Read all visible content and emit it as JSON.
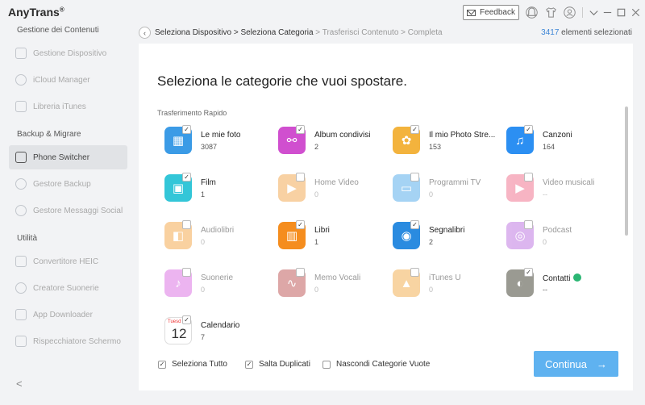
{
  "app": {
    "name": "AnyTrans",
    "reg": "®"
  },
  "titlebar": {
    "feedback_label": "Feedback",
    "icons": [
      "bell-icon",
      "tshirt-icon",
      "user-icon",
      "chevron-down-icon",
      "minimize-icon",
      "maximize-icon",
      "close-icon"
    ]
  },
  "sidebar": {
    "sections": [
      {
        "title": "Gestione dei Contenuti",
        "items": [
          {
            "label": "Gestione Dispositivo",
            "icon": "device-icon"
          },
          {
            "label": "iCloud Manager",
            "icon": "cloud-icon"
          },
          {
            "label": "Libreria iTunes",
            "icon": "music-library-icon"
          }
        ]
      },
      {
        "title": "Backup & Migrare",
        "items": [
          {
            "label": "Phone Switcher",
            "icon": "phone-switch-icon",
            "active": true
          },
          {
            "label": "Gestore Backup",
            "icon": "backup-icon"
          },
          {
            "label": "Gestore Messaggi Social",
            "icon": "chat-icon"
          }
        ]
      },
      {
        "title": "Utilità",
        "items": [
          {
            "label": "Convertitore HEIC",
            "icon": "heic-icon"
          },
          {
            "label": "Creatore Suonerie",
            "icon": "bell-icon"
          },
          {
            "label": "App Downloader",
            "icon": "download-icon"
          },
          {
            "label": "Rispecchiatore Schermo",
            "icon": "screen-mirror-icon"
          }
        ]
      }
    ],
    "collapse_glyph": "<"
  },
  "breadcrumb": {
    "back_glyph": "‹",
    "done": "Seleziona Dispositivo > Seleziona Categoria",
    "todo": " > Trasferisci Contenuto > Completa",
    "selected_count": "3417",
    "selected_suffix": " elementi selezionati"
  },
  "main": {
    "heading": "Seleziona le categorie che vuoi spostare.",
    "subheading": "Trasferimento Rapido",
    "categories": [
      {
        "name": "Le mie foto",
        "count": "3087",
        "checked": true,
        "color": "#3b9be6",
        "icon": "photo-icon",
        "glyph": "▦"
      },
      {
        "name": "Album condivisi",
        "count": "2",
        "checked": true,
        "color": "#d04fcf",
        "icon": "shared-album-icon",
        "glyph": "⚯"
      },
      {
        "name": "Il mio Photo Stre...",
        "count": "153",
        "checked": true,
        "color": "#f3b33d",
        "icon": "photo-stream-icon",
        "glyph": "✿"
      },
      {
        "name": "Canzoni",
        "count": "164",
        "checked": true,
        "color": "#2c8ff2",
        "icon": "music-note-icon",
        "glyph": "♫"
      },
      {
        "name": "Film",
        "count": "1",
        "checked": true,
        "color": "#33c6d8",
        "icon": "clapperboard-icon",
        "glyph": "▣"
      },
      {
        "name": "Home Video",
        "count": "0",
        "checked": false,
        "color": "#f09a34",
        "icon": "home-video-icon",
        "glyph": "▶"
      },
      {
        "name": "Programmi TV",
        "count": "0",
        "checked": false,
        "color": "#3aa0e8",
        "icon": "tv-icon",
        "glyph": "▭"
      },
      {
        "name": "Video musicali",
        "count": "--",
        "checked": false,
        "color": "#ee5b7c",
        "icon": "music-video-icon",
        "glyph": "▶"
      },
      {
        "name": "Audiolibri",
        "count": "0",
        "checked": false,
        "color": "#f39a2e",
        "icon": "audiobook-icon",
        "glyph": "◧"
      },
      {
        "name": "Libri",
        "count": "1",
        "checked": true,
        "color": "#f58d1e",
        "icon": "book-icon",
        "glyph": "▥"
      },
      {
        "name": "Segnalibri",
        "count": "2",
        "checked": true,
        "color": "#2a8be0",
        "icon": "bookmark-icon",
        "glyph": "◉"
      },
      {
        "name": "Podcast",
        "count": "0",
        "checked": false,
        "color": "#b35fdc",
        "icon": "podcast-icon",
        "glyph": "◎"
      },
      {
        "name": "Suonerie",
        "count": "0",
        "checked": false,
        "color": "#d65be0",
        "icon": "ringtone-bell-icon",
        "glyph": "♪"
      },
      {
        "name": "Memo Vocali",
        "count": "0",
        "checked": false,
        "color": "#b63d3d",
        "icon": "voice-memo-icon",
        "glyph": "∿"
      },
      {
        "name": "iTunes U",
        "count": "0",
        "checked": false,
        "color": "#f0a232",
        "icon": "graduation-cap-icon",
        "glyph": "▲"
      },
      {
        "name": "Contatti",
        "count": "--",
        "checked": true,
        "color": "#9a9a92",
        "icon": "contacts-icon",
        "glyph": "◐",
        "badge": "sync-icon"
      },
      {
        "name": "Calendario",
        "count": "7",
        "checked": true,
        "color": "#ffffff",
        "icon": "calendar-icon",
        "glyph": "12",
        "glyph_color": "#333",
        "cal_day": "Tuesd"
      }
    ],
    "check_glyph": "✓",
    "options": [
      {
        "label": "Seleziona Tutto",
        "checked": true
      },
      {
        "label": "Salta Duplicati",
        "checked": true
      },
      {
        "label": "Nascondi Categorie Vuote",
        "checked": false
      }
    ],
    "continue_label": "Continua",
    "continue_arrow": "→"
  }
}
